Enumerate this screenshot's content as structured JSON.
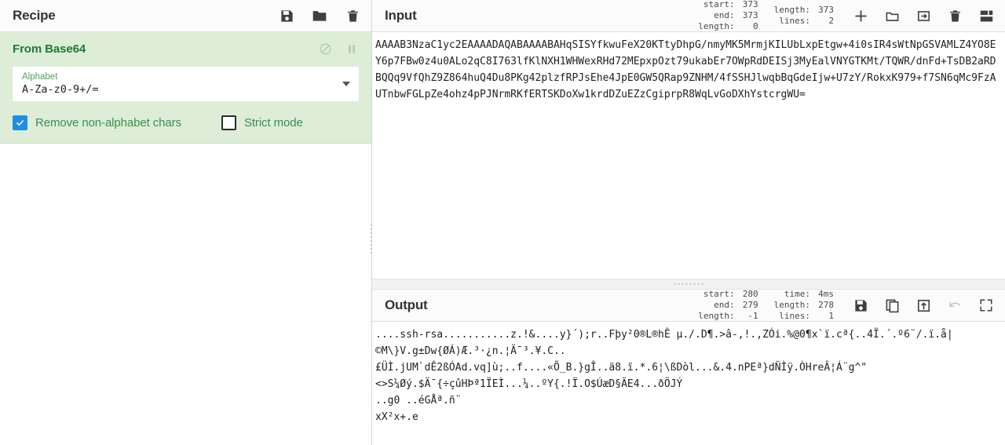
{
  "recipe": {
    "title": "Recipe",
    "icons": [
      {
        "name": "save-recipe-icon",
        "label": "save"
      },
      {
        "name": "load-recipe-icon",
        "label": "folder"
      },
      {
        "name": "clear-recipe-icon",
        "label": "trash"
      }
    ],
    "operation": {
      "name": "From Base64",
      "disable_icon_label": "disable-operation",
      "pause_icon_label": "pause-operation",
      "arg": {
        "label": "Alphabet",
        "value": "A-Za-z0-9+/="
      },
      "checkboxes": [
        {
          "label": "Remove non-alphabet chars",
          "checked": true
        },
        {
          "label": "Strict mode",
          "checked": false
        }
      ]
    }
  },
  "input": {
    "title": "Input",
    "meta_left": [
      {
        "key": "start:",
        "value": "373"
      },
      {
        "key": "end:",
        "value": "373"
      },
      {
        "key": "length:",
        "value": "0"
      }
    ],
    "meta_right": [
      {
        "key": "length:",
        "value": "373"
      },
      {
        "key": "lines:",
        "value": "2"
      }
    ],
    "icons": [
      {
        "name": "add-input-tab-icon",
        "label": "plus"
      },
      {
        "name": "open-folder-as-input-icon",
        "label": "folder"
      },
      {
        "name": "open-file-as-input-icon",
        "label": "file-into-box"
      },
      {
        "name": "clear-input-icon",
        "label": "trash"
      },
      {
        "name": "reset-pane-layout-icon",
        "label": "layout"
      }
    ],
    "text": "AAAAB3NzaC1yc2EAAAADAQABAAAABAHqSISYfkwuFeX20KTtyDhpG/nmyMK5MrmjKILUbLxpEtgw+4i0sIR4sWtNpGSVAMLZ4YO8EY6p7FBw0z4u0ALo2qC8I763lfKlNXH1WHWexRHd72MEpxpOzt79ukabEr7OWpRdDEISj3MyEalVNYGTKMt/TQWR/dnFd+TsDB2aRDBQQq9VfQhZ9Z864huQ4Du8PKg42plzfRPJsEhe4JpE0GW5QRap9ZNHM/4fSSHJlwqbBqGdeIjw+U7zY/RokxK979+f7SN6qMc9FzAUTnbwFGLpZe4ohz4pPJNrmRKfERTSKDoXw1krdDZuEZzCgiprpR8WqLvGoDXhYstcrgWU="
  },
  "output": {
    "title": "Output",
    "meta_left": [
      {
        "key": "start:",
        "value": "280"
      },
      {
        "key": "end:",
        "value": "279"
      },
      {
        "key": "length:",
        "value": "-1"
      }
    ],
    "meta_right": [
      {
        "key": "time:",
        "value": "4ms"
      },
      {
        "key": "length:",
        "value": "278"
      },
      {
        "key": "lines:",
        "value": "1"
      }
    ],
    "icons": [
      {
        "name": "save-output-icon",
        "label": "save"
      },
      {
        "name": "copy-output-icon",
        "label": "copy"
      },
      {
        "name": "replace-input-with-output-icon",
        "label": "box-out-arrow"
      },
      {
        "name": "undo-bake-icon",
        "label": "undo",
        "disabled": true
      },
      {
        "name": "maximise-output-icon",
        "label": "expand"
      }
    ],
    "lines": [
      "....ssh-rsa...........z.!&....y}´);r..Fþy²0®L®hÊ µ./.D¶.>â-,!.,ZÓi.%@0¶x`ï.cª{..4Ï.´.º6¨/.ï.å|",
      "©M\\}V.g±Dw{ØÁ)Æ.³·¿n.¦Ä¯³.¥.C..",
      "£ÜÌ.jUM`dÊ2ßÓAd.vq]ù;..f....«Õ_B.}gÎ..ä8.ï.*.6¦\\ßDòl...&.4.nPEª}dÑÌÿ.ÒHreÂ¦Á¨g^\"",
      "<>S¼Øý.$Ä¯{÷çûHÞª1ÏEÌ...¼..ºY{.!Ï.O$ÚæD§ÄE4...ðÖJÝ",
      "..g0 ..éGÅª.ñ¨",
      "xX²x+.e"
    ]
  }
}
